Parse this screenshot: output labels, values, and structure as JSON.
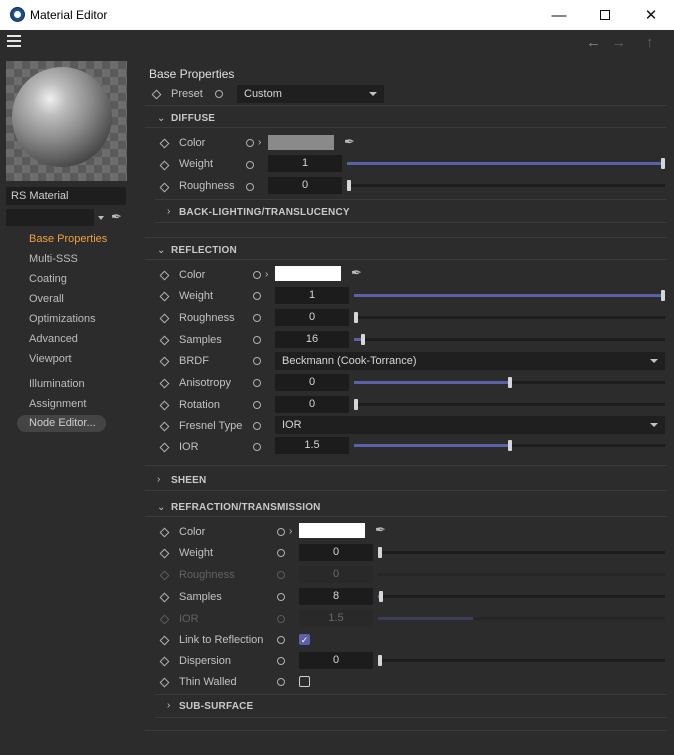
{
  "window": {
    "title": "Material Editor"
  },
  "nav": {
    "back": "←",
    "forward": "→",
    "up": "↑"
  },
  "sidebar": {
    "material_name": "RS Material",
    "items": [
      "Base Properties",
      "Multi-SSS",
      "Coating",
      "Overall",
      "Optimizations",
      "Advanced",
      "Viewport",
      "Illumination",
      "Assignment"
    ],
    "node_editor": "Node Editor..."
  },
  "main": {
    "title": "Base Properties",
    "preset": {
      "label": "Preset",
      "value": "Custom"
    },
    "diffuse": {
      "title": "DIFFUSE",
      "color_label": "Color",
      "color": "#8a8a8a",
      "weight": {
        "label": "Weight",
        "value": "1",
        "level": 1.0
      },
      "roughness": {
        "label": "Roughness",
        "value": "0",
        "level": 0.0
      },
      "backlight": "BACK-LIGHTING/TRANSLUCENCY"
    },
    "reflection": {
      "title": "REFLECTION",
      "color_label": "Color",
      "color": "#ffffff",
      "weight": {
        "label": "Weight",
        "value": "1",
        "level": 1.0
      },
      "roughness": {
        "label": "Roughness",
        "value": "0",
        "level": 0.0
      },
      "samples": {
        "label": "Samples",
        "value": "16",
        "level": 0.03
      },
      "brdf": {
        "label": "BRDF",
        "value": "Beckmann (Cook-Torrance)"
      },
      "anisotropy": {
        "label": "Anisotropy",
        "value": "0",
        "level": 0.5
      },
      "rotation": {
        "label": "Rotation",
        "value": "0",
        "level": 0.0
      },
      "fresnel": {
        "label": "Fresnel Type",
        "value": "IOR"
      },
      "ior": {
        "label": "IOR",
        "value": "1.5",
        "level": 0.5
      }
    },
    "sheen": {
      "title": "SHEEN"
    },
    "refraction": {
      "title": "REFRACTION/TRANSMISSION",
      "color_label": "Color",
      "color": "#ffffff",
      "weight": {
        "label": "Weight",
        "value": "0",
        "level": 0.0
      },
      "roughness": {
        "label": "Roughness",
        "value": "0",
        "level": 0.0
      },
      "samples": {
        "label": "Samples",
        "value": "8",
        "level": 0.01
      },
      "ior": {
        "label": "IOR",
        "value": "1.5",
        "level": 0.33
      },
      "link": {
        "label": "Link to Reflection",
        "checked": true
      },
      "dispersion": {
        "label": "Dispersion",
        "value": "0",
        "level": 0.0
      },
      "thin": {
        "label": "Thin Walled",
        "checked": false
      }
    },
    "subsurface": {
      "title": "SUB-SURFACE"
    }
  },
  "colors": {
    "accent": "#5962a8",
    "active_nav": "#f0a040"
  }
}
